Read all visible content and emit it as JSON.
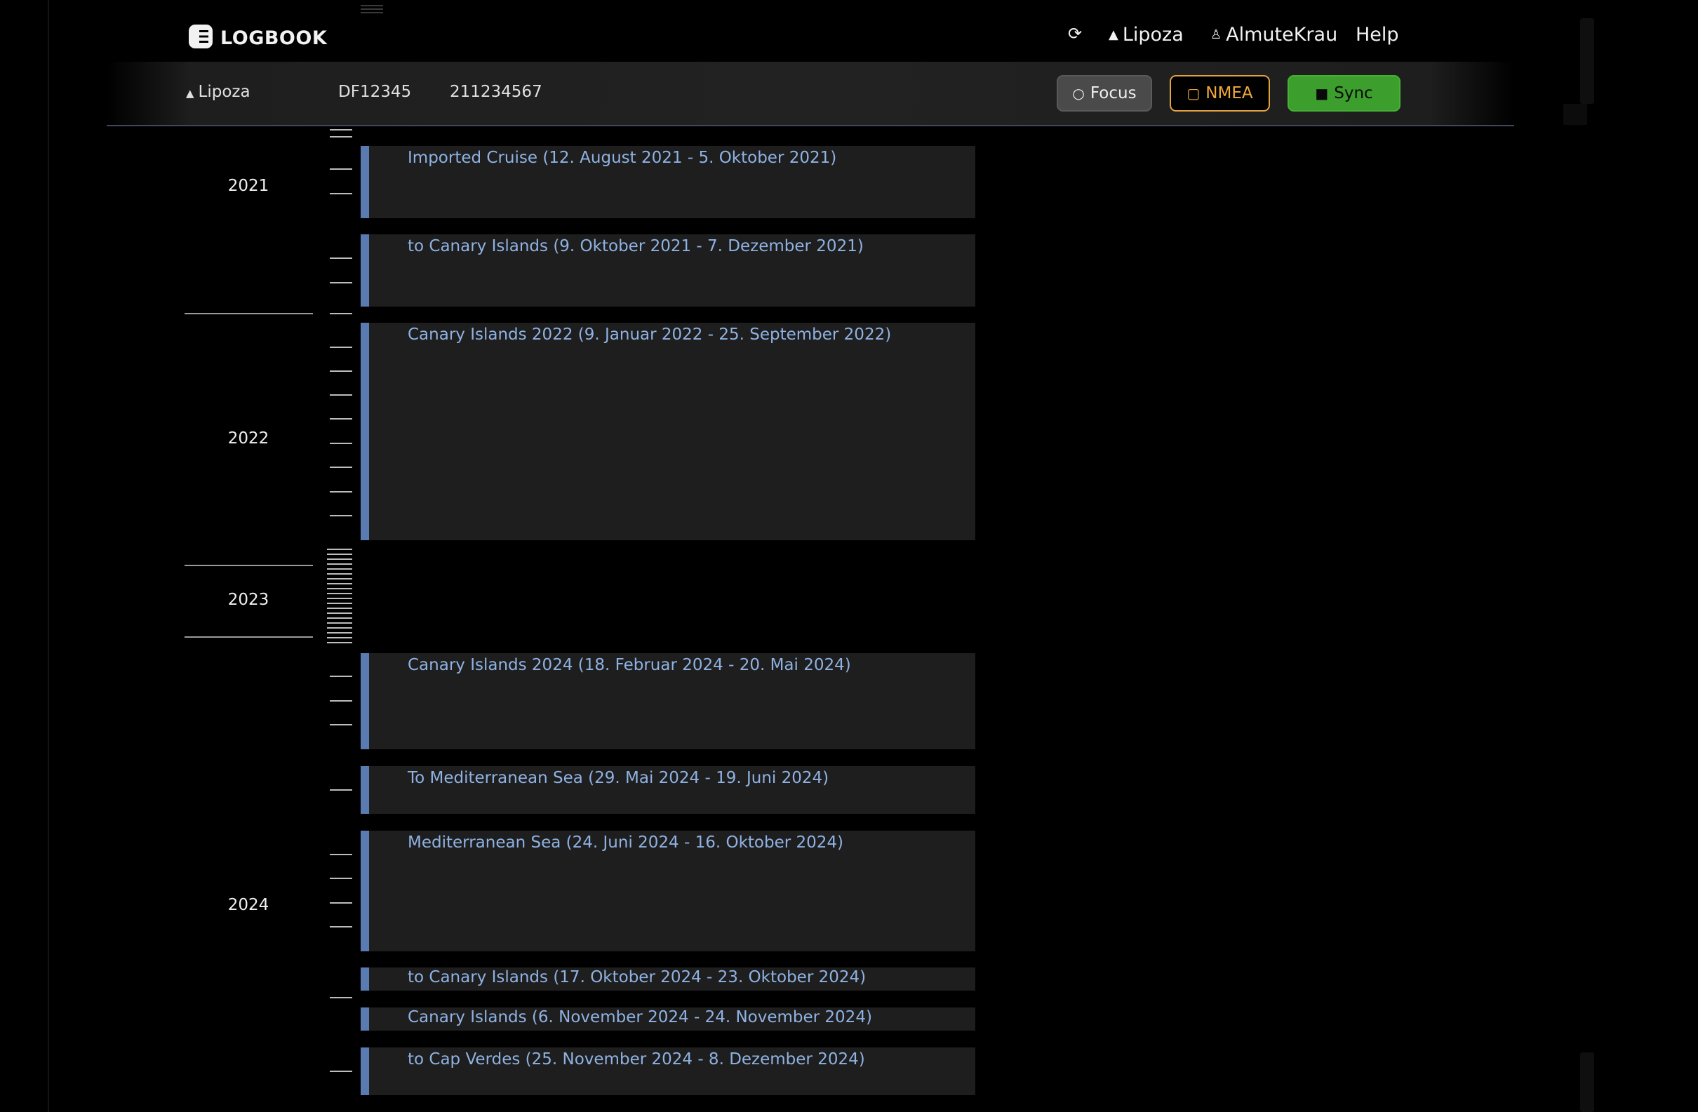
{
  "app": {
    "logo_text": "LOGBOOK",
    "logo_icon": "logbook-logo-icon"
  },
  "nav": {
    "refresh_icon": "refresh-icon",
    "boat_label": "Lipoza",
    "user_label": "AlmuteKrau",
    "help_label": "Help"
  },
  "vessel": {
    "name": "Lipoza",
    "call_sign": "DF12345",
    "mmsi": "211234567"
  },
  "buttons": {
    "focus": "Focus",
    "nmea": "NMEA",
    "sync": "Sync"
  },
  "colors": {
    "accent": "#5a7bb1",
    "link": "#8fb2e3",
    "nmea": "#e2a23c",
    "sync": "#3c9e2c",
    "background": "#000000"
  },
  "timeline": {
    "years": [
      "2021",
      "2022",
      "2023",
      "2024"
    ],
    "trips": [
      "Imported Cruise (12. August 2021 - 5. Oktober 2021)",
      "to Canary Islands (9. Oktober 2021 - 7. Dezember 2021)",
      "Canary Islands 2022 (9. Januar 2022 - 25. September 2022)",
      "Canary Islands 2024 (18. Februar 2024 - 20. Mai 2024)",
      "To Mediterranean Sea (29. Mai 2024 - 19. Juni 2024)",
      "Mediterranean Sea (24. Juni 2024 - 16. Oktober 2024)",
      "to Canary Islands (17. Oktober 2024 - 23. Oktober 2024)",
      "Canary Islands (6. November 2024 - 24. November 2024)",
      "to Cap Verdes (25. November 2024 - 8. Dezember 2024)"
    ]
  }
}
